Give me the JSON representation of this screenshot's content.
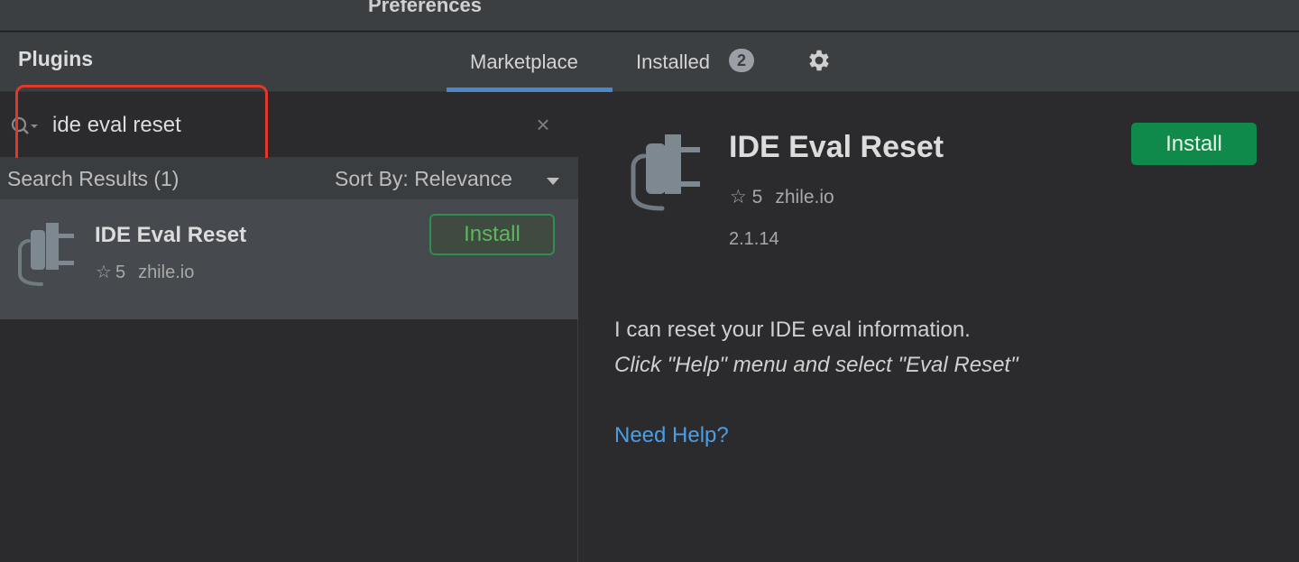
{
  "window": {
    "title": "Preferences"
  },
  "header": {
    "title": "Plugins",
    "tabs": [
      {
        "label": "Marketplace",
        "active": true
      },
      {
        "label": "Installed",
        "badge": "2"
      }
    ],
    "settings_icon": "gear-icon"
  },
  "search": {
    "value": "ide eval reset",
    "icon": "search-icon",
    "clear_icon": "close-icon",
    "clear_glyph": "×"
  },
  "results": {
    "label": "Search Results (1)",
    "sort_label": "Sort By: Relevance",
    "items": [
      {
        "name": "IDE Eval Reset",
        "rating": "5",
        "star_glyph": "☆",
        "vendor": "zhile.io",
        "install_label": "Install",
        "icon": "plugin-plug-icon"
      }
    ]
  },
  "detail": {
    "name": "IDE Eval Reset",
    "rating": "5",
    "star_glyph": "☆",
    "vendor": "zhile.io",
    "version": "2.1.14",
    "install_label": "Install",
    "description": "I can reset your IDE eval information.",
    "description_italic": "Click \"Help\" menu and select \"Eval Reset\"",
    "help_link": "Need Help?",
    "icon": "plugin-plug-icon"
  },
  "colors": {
    "accent_tab": "#4a88c7",
    "install_green": "#0f8a4a",
    "highlight_red": "#e0392b",
    "link_blue": "#4a9ee8"
  }
}
